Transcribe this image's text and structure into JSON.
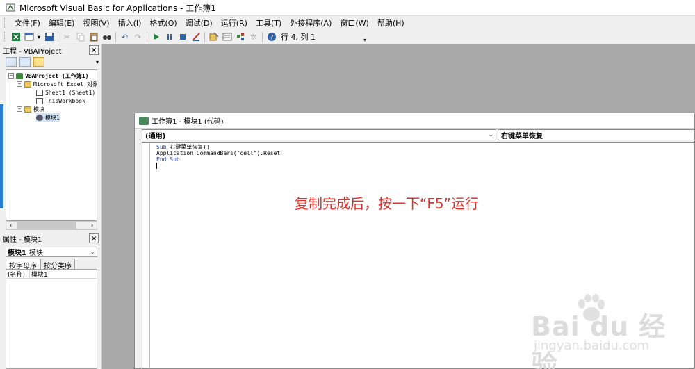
{
  "window": {
    "title": "Microsoft Visual Basic for Applications - 工作簿1"
  },
  "menu": [
    "文件(F)",
    "编辑(E)",
    "视图(V)",
    "插入(I)",
    "格式(O)",
    "调试(D)",
    "运行(R)",
    "工具(T)",
    "外接程序(A)",
    "窗口(W)",
    "帮助(H)"
  ],
  "toolbar": {
    "position": "行 4, 列 1"
  },
  "project": {
    "title": "工程 - VBAProject",
    "close": "✕",
    "tree": {
      "root": "VBAProject (工作簿1)",
      "excel_objects": "Microsoft Excel 对象",
      "sheet1": "Sheet1 (Sheet1)",
      "thisworkbook": "ThisWorkbook",
      "modules": "模块",
      "module1": "模块1"
    }
  },
  "properties": {
    "title": "属性 - 模块1",
    "close": "✕",
    "object_name": "模块1",
    "object_type": "模块",
    "tabs": [
      "按字母序",
      "按分类序"
    ],
    "rows": [
      {
        "key": "(名称)",
        "value": "模块1"
      }
    ]
  },
  "code_window": {
    "title": "工作簿1 - 模块1 (代码)",
    "object_combo": "(通用)",
    "proc_combo": "右键菜单恢复",
    "lines": {
      "l1_kw": "Sub",
      "l1_rest": " 右键菜单恢复()",
      "l2": "Application.CommandBars(\"cell\").Reset",
      "l3": "End Sub"
    }
  },
  "annotation": "复制完成后，按一下“F5”运行",
  "watermark": {
    "main": "Bai du 经验",
    "sub": "jingyan.baidu.com"
  },
  "colors": {
    "accent": "#e0302b",
    "keyword": "#1f3fa8",
    "mdi_bg": "#a9a9a9"
  }
}
